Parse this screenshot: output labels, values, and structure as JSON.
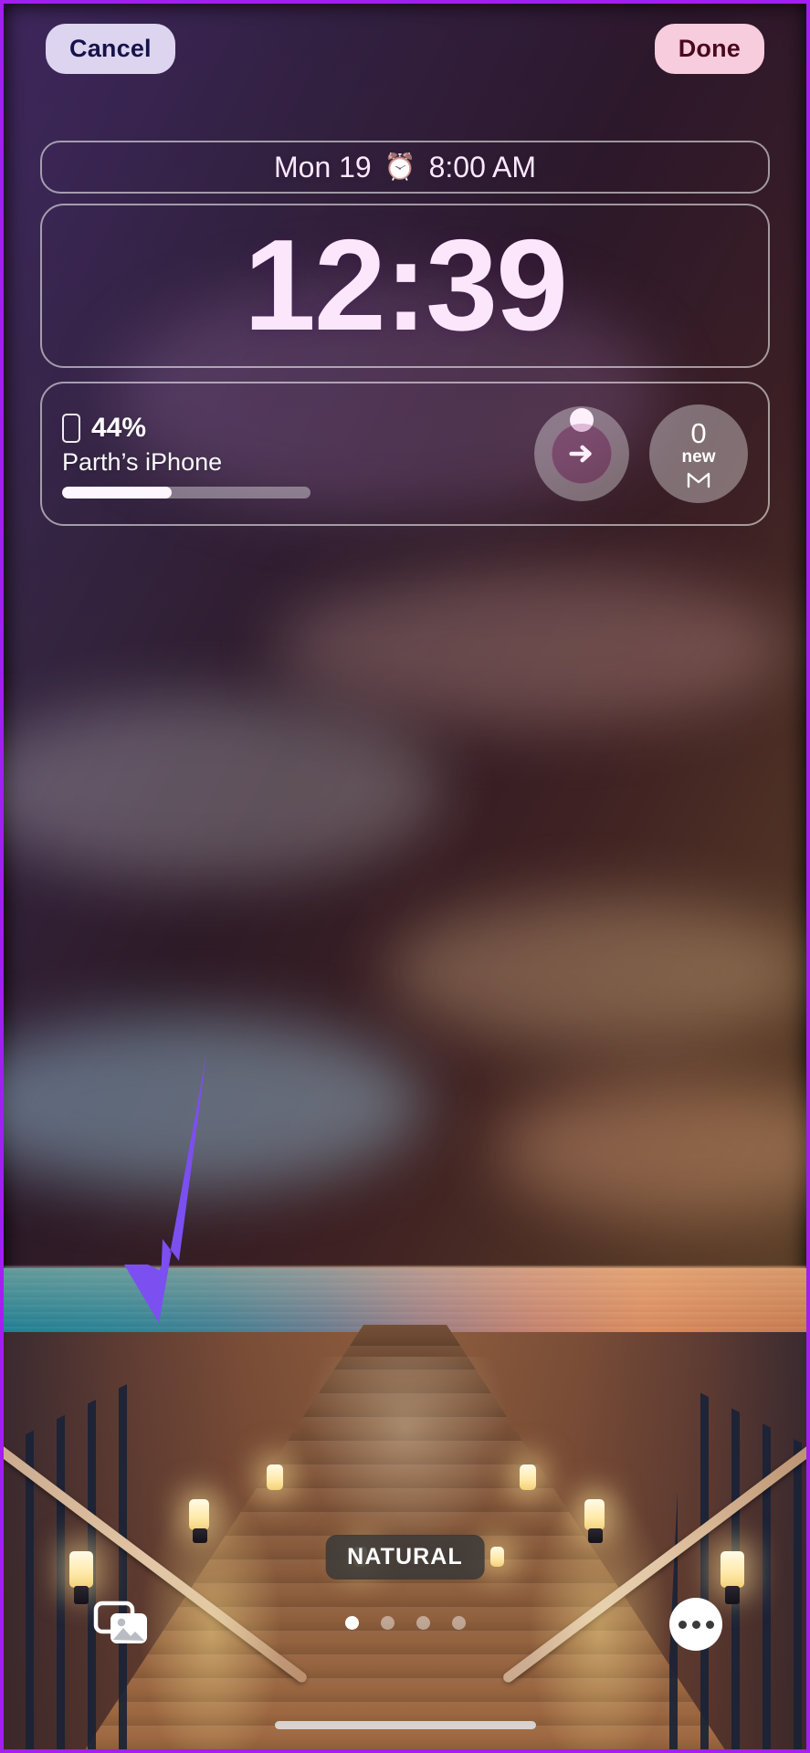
{
  "topbar": {
    "cancel_label": "Cancel",
    "done_label": "Done"
  },
  "lockscreen": {
    "date_text": "Mon 19",
    "alarm_icon": "alarm-clock-icon",
    "alarm_time": "8:00 AM",
    "time": "12:39",
    "widgets": {
      "battery": {
        "icon": "iphone-icon",
        "percent_label": "44%",
        "device_name": "Parth’s iPhone",
        "fill_percent": 44
      },
      "fitness_ring": {
        "icon": "move-arrow-icon"
      },
      "mail": {
        "count": "0",
        "label": "new",
        "icon": "gmail-m-icon"
      }
    }
  },
  "bottom": {
    "style_label": "NATURAL",
    "page_dots": 4,
    "active_dot_index": 0,
    "photos_button_icon": "photo-stack-icon",
    "more_button_icon": "ellipsis-icon"
  },
  "colors": {
    "cancel_pill_bg": "#ddd4ef",
    "cancel_pill_text": "#16124a",
    "done_pill_bg": "#f7ccdd",
    "done_pill_text": "#49091c",
    "chip_bg": "#3a3838",
    "annotation_arrow": "#7c4ff0",
    "capture_border": "#a21ff0"
  }
}
